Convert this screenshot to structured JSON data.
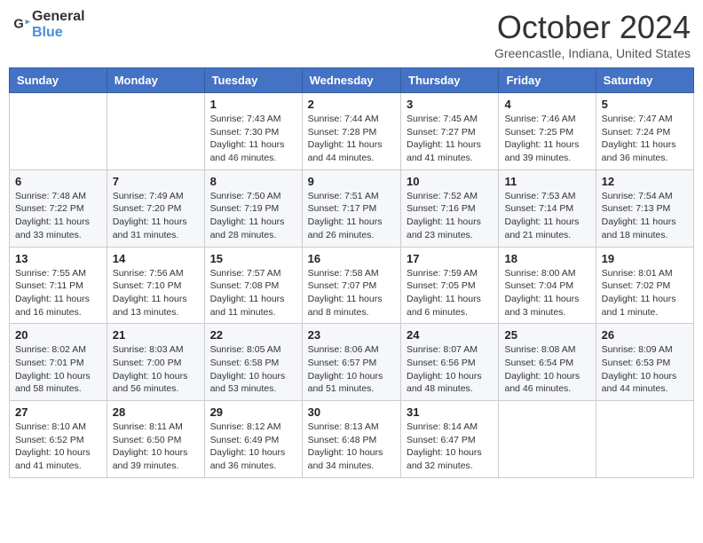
{
  "header": {
    "logo_general": "General",
    "logo_blue": "Blue",
    "month_title": "October 2024",
    "location": "Greencastle, Indiana, United States"
  },
  "weekdays": [
    "Sunday",
    "Monday",
    "Tuesday",
    "Wednesday",
    "Thursday",
    "Friday",
    "Saturday"
  ],
  "weeks": [
    [
      {
        "day": "",
        "info": ""
      },
      {
        "day": "",
        "info": ""
      },
      {
        "day": "1",
        "info": "Sunrise: 7:43 AM\nSunset: 7:30 PM\nDaylight: 11 hours and 46 minutes."
      },
      {
        "day": "2",
        "info": "Sunrise: 7:44 AM\nSunset: 7:28 PM\nDaylight: 11 hours and 44 minutes."
      },
      {
        "day": "3",
        "info": "Sunrise: 7:45 AM\nSunset: 7:27 PM\nDaylight: 11 hours and 41 minutes."
      },
      {
        "day": "4",
        "info": "Sunrise: 7:46 AM\nSunset: 7:25 PM\nDaylight: 11 hours and 39 minutes."
      },
      {
        "day": "5",
        "info": "Sunrise: 7:47 AM\nSunset: 7:24 PM\nDaylight: 11 hours and 36 minutes."
      }
    ],
    [
      {
        "day": "6",
        "info": "Sunrise: 7:48 AM\nSunset: 7:22 PM\nDaylight: 11 hours and 33 minutes."
      },
      {
        "day": "7",
        "info": "Sunrise: 7:49 AM\nSunset: 7:20 PM\nDaylight: 11 hours and 31 minutes."
      },
      {
        "day": "8",
        "info": "Sunrise: 7:50 AM\nSunset: 7:19 PM\nDaylight: 11 hours and 28 minutes."
      },
      {
        "day": "9",
        "info": "Sunrise: 7:51 AM\nSunset: 7:17 PM\nDaylight: 11 hours and 26 minutes."
      },
      {
        "day": "10",
        "info": "Sunrise: 7:52 AM\nSunset: 7:16 PM\nDaylight: 11 hours and 23 minutes."
      },
      {
        "day": "11",
        "info": "Sunrise: 7:53 AM\nSunset: 7:14 PM\nDaylight: 11 hours and 21 minutes."
      },
      {
        "day": "12",
        "info": "Sunrise: 7:54 AM\nSunset: 7:13 PM\nDaylight: 11 hours and 18 minutes."
      }
    ],
    [
      {
        "day": "13",
        "info": "Sunrise: 7:55 AM\nSunset: 7:11 PM\nDaylight: 11 hours and 16 minutes."
      },
      {
        "day": "14",
        "info": "Sunrise: 7:56 AM\nSunset: 7:10 PM\nDaylight: 11 hours and 13 minutes."
      },
      {
        "day": "15",
        "info": "Sunrise: 7:57 AM\nSunset: 7:08 PM\nDaylight: 11 hours and 11 minutes."
      },
      {
        "day": "16",
        "info": "Sunrise: 7:58 AM\nSunset: 7:07 PM\nDaylight: 11 hours and 8 minutes."
      },
      {
        "day": "17",
        "info": "Sunrise: 7:59 AM\nSunset: 7:05 PM\nDaylight: 11 hours and 6 minutes."
      },
      {
        "day": "18",
        "info": "Sunrise: 8:00 AM\nSunset: 7:04 PM\nDaylight: 11 hours and 3 minutes."
      },
      {
        "day": "19",
        "info": "Sunrise: 8:01 AM\nSunset: 7:02 PM\nDaylight: 11 hours and 1 minute."
      }
    ],
    [
      {
        "day": "20",
        "info": "Sunrise: 8:02 AM\nSunset: 7:01 PM\nDaylight: 10 hours and 58 minutes."
      },
      {
        "day": "21",
        "info": "Sunrise: 8:03 AM\nSunset: 7:00 PM\nDaylight: 10 hours and 56 minutes."
      },
      {
        "day": "22",
        "info": "Sunrise: 8:05 AM\nSunset: 6:58 PM\nDaylight: 10 hours and 53 minutes."
      },
      {
        "day": "23",
        "info": "Sunrise: 8:06 AM\nSunset: 6:57 PM\nDaylight: 10 hours and 51 minutes."
      },
      {
        "day": "24",
        "info": "Sunrise: 8:07 AM\nSunset: 6:56 PM\nDaylight: 10 hours and 48 minutes."
      },
      {
        "day": "25",
        "info": "Sunrise: 8:08 AM\nSunset: 6:54 PM\nDaylight: 10 hours and 46 minutes."
      },
      {
        "day": "26",
        "info": "Sunrise: 8:09 AM\nSunset: 6:53 PM\nDaylight: 10 hours and 44 minutes."
      }
    ],
    [
      {
        "day": "27",
        "info": "Sunrise: 8:10 AM\nSunset: 6:52 PM\nDaylight: 10 hours and 41 minutes."
      },
      {
        "day": "28",
        "info": "Sunrise: 8:11 AM\nSunset: 6:50 PM\nDaylight: 10 hours and 39 minutes."
      },
      {
        "day": "29",
        "info": "Sunrise: 8:12 AM\nSunset: 6:49 PM\nDaylight: 10 hours and 36 minutes."
      },
      {
        "day": "30",
        "info": "Sunrise: 8:13 AM\nSunset: 6:48 PM\nDaylight: 10 hours and 34 minutes."
      },
      {
        "day": "31",
        "info": "Sunrise: 8:14 AM\nSunset: 6:47 PM\nDaylight: 10 hours and 32 minutes."
      },
      {
        "day": "",
        "info": ""
      },
      {
        "day": "",
        "info": ""
      }
    ]
  ]
}
